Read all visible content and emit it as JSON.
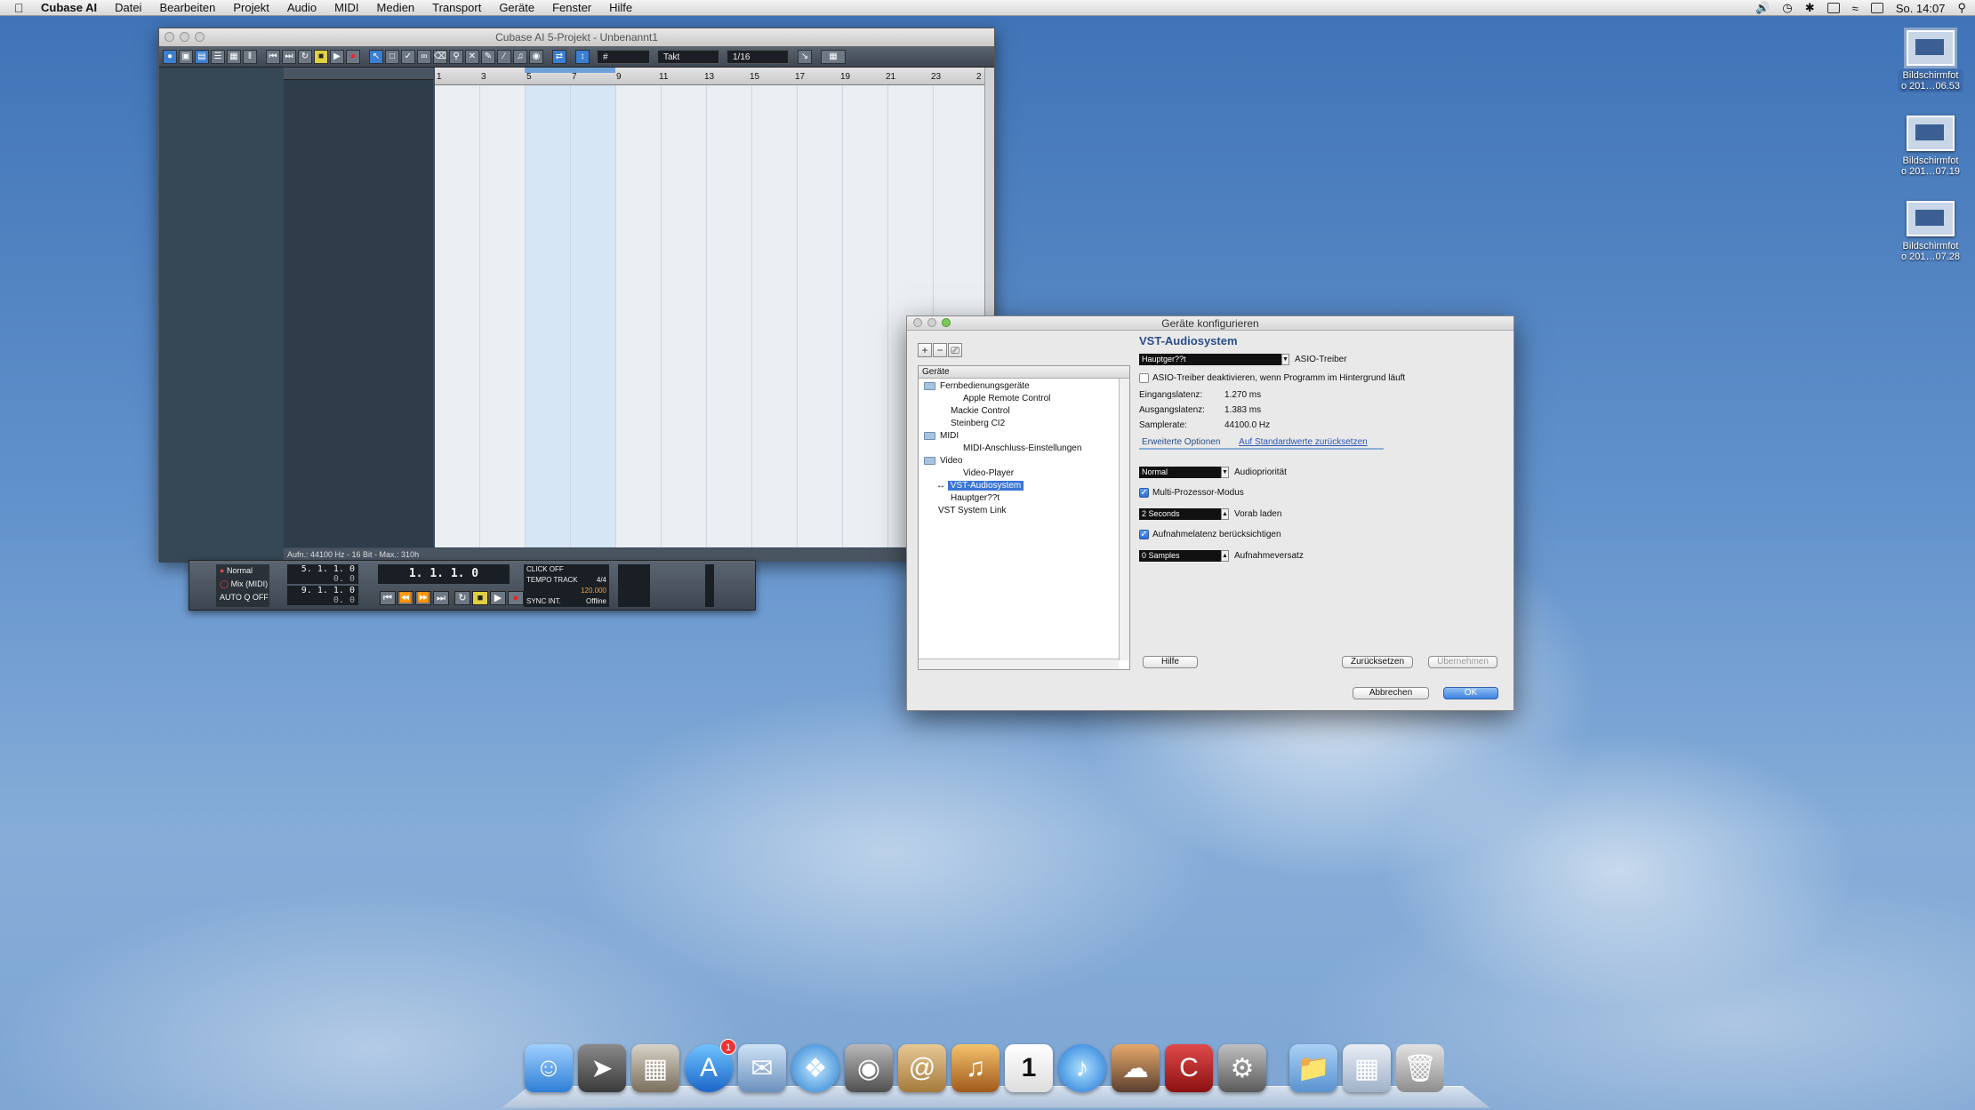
{
  "menubar": {
    "app": "Cubase AI",
    "items": [
      "Datei",
      "Bearbeiten",
      "Projekt",
      "Audio",
      "MIDI",
      "Medien",
      "Transport",
      "Geräte",
      "Fenster",
      "Hilfe"
    ],
    "clock": "So. 14:07"
  },
  "desktop": {
    "icons": [
      {
        "line1": "Bildschirmfot",
        "line2": "o 201…06.53"
      },
      {
        "line1": "Bildschirmfot",
        "line2": "o 201…07.19"
      },
      {
        "line1": "Bildschirmfot",
        "line2": "o 201…07.28"
      }
    ]
  },
  "cubase": {
    "title": "Cubase AI 5-Projekt - Unbenannt1",
    "snap_type": "Takt",
    "quantize": "1/16",
    "ruler": [
      "1",
      "3",
      "5",
      "7",
      "9",
      "11",
      "13",
      "15",
      "17",
      "19",
      "21",
      "23",
      "2"
    ],
    "status": "Aufn.: 44100 Hz - 16 Bit - Max.: 310h"
  },
  "transport": {
    "mode": "Normal",
    "cycle": "Mix (MIDI)",
    "auto": "AUTO Q",
    "auto_val": "OFF",
    "left_locator": "5. 1. 1.   0",
    "left_sub": "0.   0",
    "right_locator": "9. 1. 1.   0",
    "right_sub": "0.   0",
    "position": "1. 1. 1.   0",
    "click": "CLICK",
    "click_val": "OFF",
    "tempo": "TEMPO",
    "track": "TRACK",
    "signature": "4/4",
    "bpm": "120.000",
    "sync": "SYNC",
    "int": "INT.",
    "offline": "Offline"
  },
  "dialog": {
    "title": "Geräte konfigurieren",
    "panel_header": "Geräte",
    "tree": [
      {
        "label": "Fernbedienungsgeräte",
        "indent": 0,
        "folder": true
      },
      {
        "label": "Apple Remote Control",
        "indent": 2,
        "folder": false
      },
      {
        "label": "Mackie Control",
        "indent": 1,
        "folder": false
      },
      {
        "label": "Steinberg CI2",
        "indent": 1,
        "folder": false
      },
      {
        "label": "MIDI",
        "indent": 0,
        "folder": true
      },
      {
        "label": "MIDI-Anschluss-Einstellungen",
        "indent": 2,
        "folder": false
      },
      {
        "label": "Video",
        "indent": 0,
        "folder": true
      },
      {
        "label": "Video-Player",
        "indent": 2,
        "folder": false
      },
      {
        "label": "VST-Audiosystem",
        "indent": 1,
        "folder": false,
        "selected": true
      },
      {
        "label": "Hauptger??t",
        "indent": 1,
        "folder": false
      },
      {
        "label": "VST System Link",
        "indent": 0,
        "folder": false
      }
    ],
    "section_title": "VST-Audiosystem",
    "driver": "Hauptger??t",
    "driver_label": "ASIO-Treiber",
    "asio_deactivate": "ASIO-Treiber deaktivieren, wenn Programm im Hintergrund läuft",
    "input_latency_label": "Eingangslatenz:",
    "input_latency": "1.270 ms",
    "output_latency_label": "Ausgangslatenz:",
    "output_latency": "1.383 ms",
    "samplerate_label": "Samplerate:",
    "samplerate": "44100.0 Hz",
    "tab_advanced": "Erweiterte Optionen",
    "tab_reset_defaults": "Auf Standardwerte zurücksetzen",
    "audio_priority": "Normal",
    "audio_priority_label": "Audiopriorität",
    "multiprocessor": "Multi-Prozessor-Modus",
    "preload": "2 Seconds",
    "preload_label": "Vorab laden",
    "record_latency": "Aufnahmelatenz berücksichtigen",
    "record_offset": "0 Samples",
    "record_offset_label": "Aufnahmeversatz",
    "help": "Hilfe",
    "reset": "Zurücksetzen",
    "apply": "Übernehmen",
    "cancel": "Abbrechen",
    "ok": "OK"
  },
  "dock": {
    "badge": "1",
    "cal_day": "1"
  }
}
